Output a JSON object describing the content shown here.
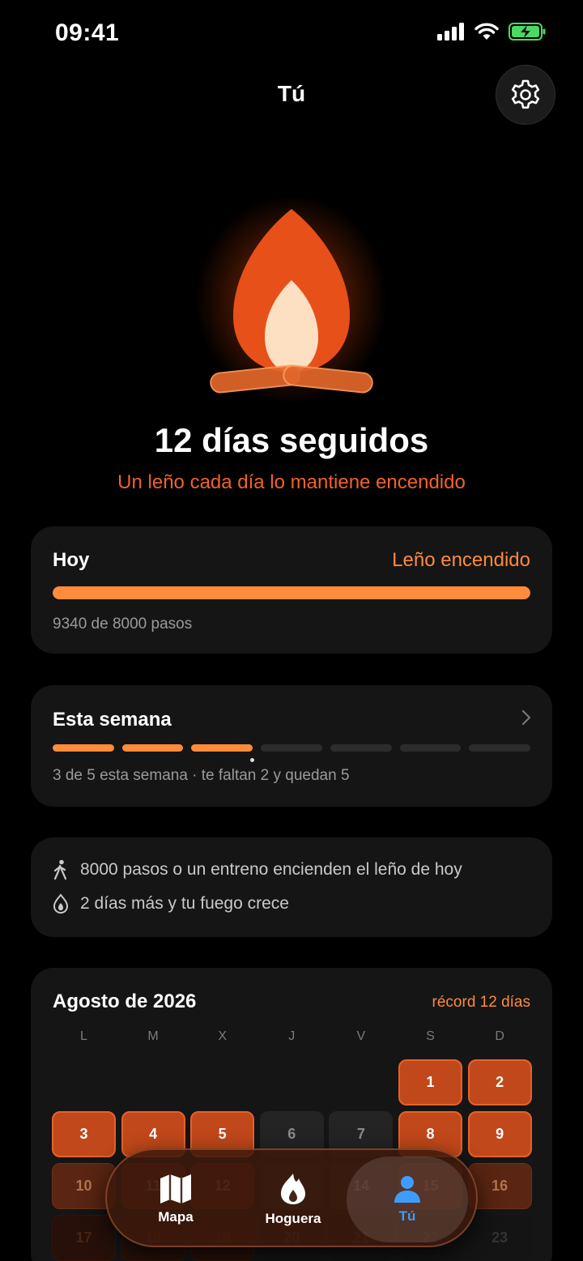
{
  "status": {
    "time": "09:41",
    "icons": [
      "signal-icon",
      "wifi-icon",
      "battery-charging-icon"
    ],
    "battery_color": "#4cd964"
  },
  "header": {
    "title": "Tú",
    "settings_icon": "gear-icon"
  },
  "streak": {
    "title": "12 días seguidos",
    "subtitle": "Un leño cada día lo mantiene encendido",
    "accent": "#f0622a"
  },
  "today": {
    "label": "Hoy",
    "status": "Leño encendido",
    "progress": 1.0,
    "steps_text": "9340 de 8000 pasos"
  },
  "week": {
    "label": "Esta semana",
    "segments_done": 3,
    "segments_total": 7,
    "summary": "3 de 5 esta semana · te faltan 2 y quedan 5"
  },
  "tips": [
    {
      "icon": "walking-icon",
      "text": "8000 pasos o un entreno encienden el leño de hoy"
    },
    {
      "icon": "flame-drop-icon",
      "text": "2 días más y tu fuego crece"
    }
  ],
  "calendar": {
    "title": "Agosto de 2026",
    "record": "récord 12 días",
    "weekdays": [
      "L",
      "M",
      "X",
      "J",
      "V",
      "S",
      "D"
    ],
    "weeks": [
      [
        null,
        null,
        null,
        null,
        null,
        {
          "d": "1",
          "s": "lit"
        },
        {
          "d": "2",
          "s": "lit"
        }
      ],
      [
        {
          "d": "3",
          "s": "lit"
        },
        {
          "d": "4",
          "s": "lit"
        },
        {
          "d": "5",
          "s": "lit"
        },
        {
          "d": "6",
          "s": "off"
        },
        {
          "d": "7",
          "s": "off"
        },
        {
          "d": "8",
          "s": "lit"
        },
        {
          "d": "9",
          "s": "lit"
        }
      ],
      [
        {
          "d": "10",
          "s": "dim"
        },
        {
          "d": "11",
          "s": "dim"
        },
        {
          "d": "12",
          "s": "dim"
        },
        {
          "d": "13",
          "s": "off"
        },
        {
          "d": "14",
          "s": "off"
        },
        {
          "d": "15",
          "s": "dim"
        },
        {
          "d": "16",
          "s": "dim"
        }
      ],
      [
        {
          "d": "17",
          "s": "faint"
        },
        {
          "d": "18",
          "s": "faint"
        },
        {
          "d": "19",
          "s": "faint"
        },
        {
          "d": "20",
          "s": "faint-off"
        },
        {
          "d": "21",
          "s": "faint-off"
        },
        {
          "d": "22",
          "s": "faint-off"
        },
        {
          "d": "23",
          "s": "faint-off"
        }
      ]
    ]
  },
  "tabs": [
    {
      "label": "Mapa",
      "icon": "map-icon",
      "active": false
    },
    {
      "label": "Hoguera",
      "icon": "flame-icon",
      "active": false
    },
    {
      "label": "Tú",
      "icon": "person-icon",
      "active": true
    }
  ]
}
